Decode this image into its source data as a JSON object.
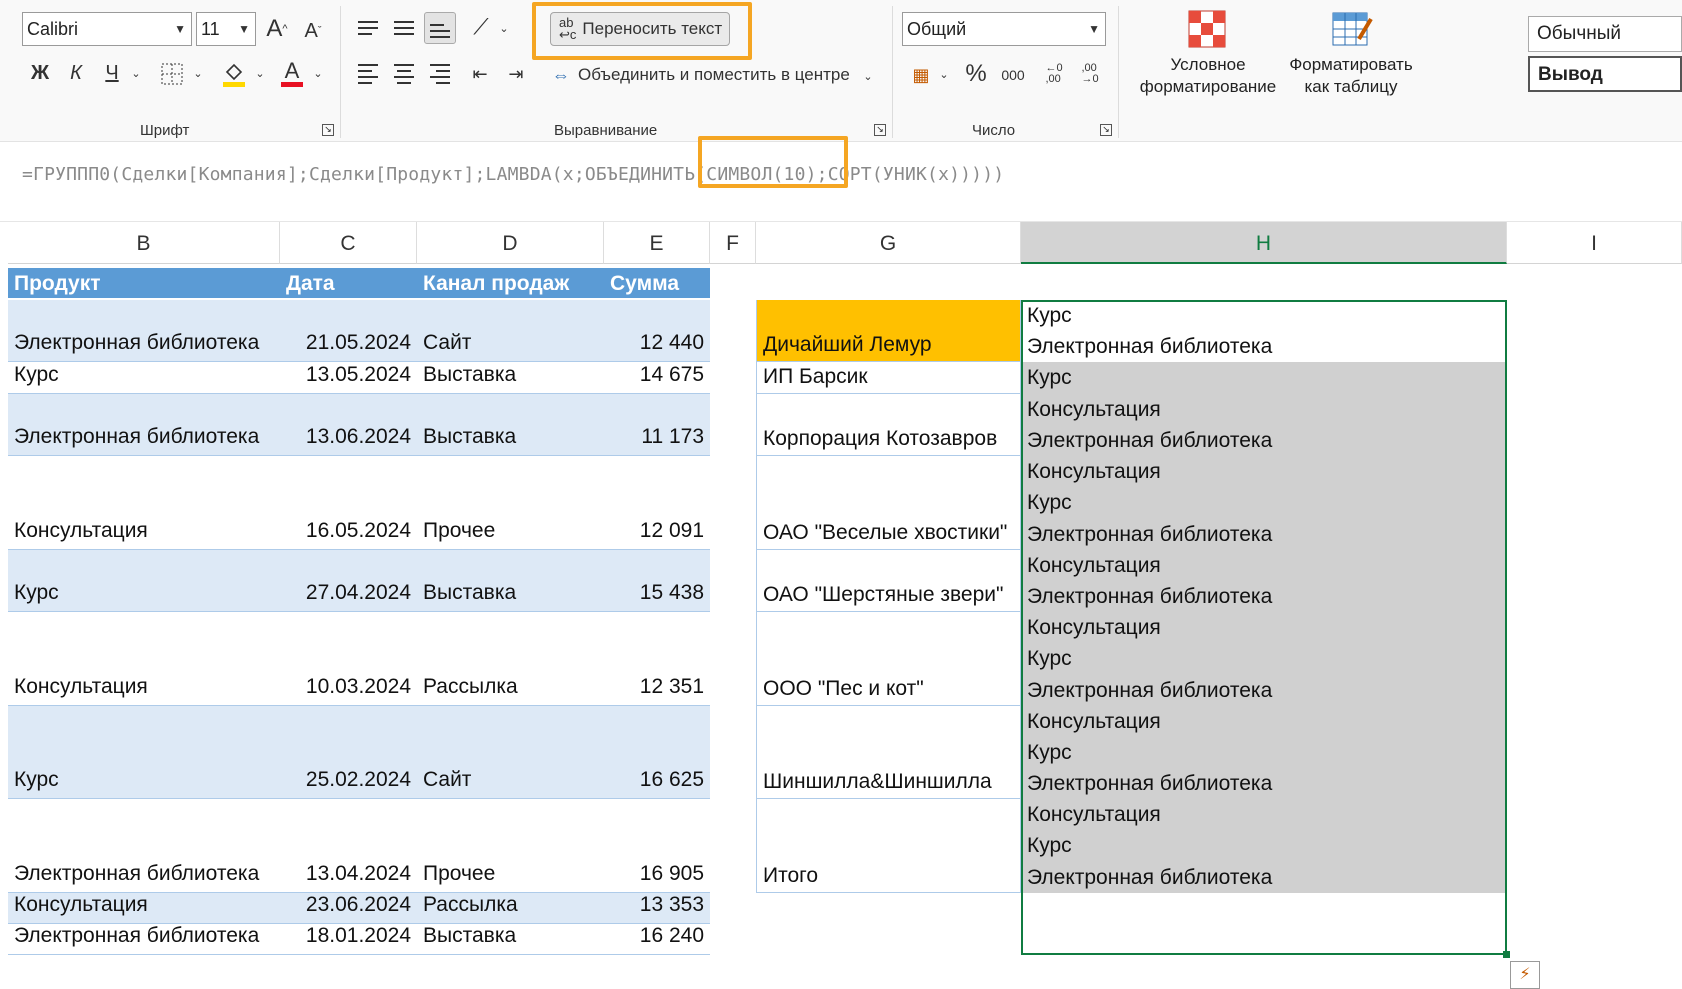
{
  "ribbon": {
    "font": {
      "name": "Calibri",
      "size": "11",
      "bold": "Ж",
      "italic": "К",
      "underline": "Ч",
      "increase": "A",
      "decrease": "A",
      "group_label": "Шрифт",
      "fill_color": "#ffd800",
      "font_color": "#e81123"
    },
    "alignment": {
      "wrap_text": "Переносить текст",
      "merge_center": "Объединить и поместить в центре",
      "group_label": "Выравнивание"
    },
    "number": {
      "format": "Общий",
      "percent": "%",
      "thousands": "000",
      "group_label": "Число"
    },
    "styles": {
      "conditional_formatting": "Условное форматирование",
      "format_as_table": "Форматировать как таблицу",
      "normal": "Обычный",
      "output": "Вывод"
    }
  },
  "formula_bar": {
    "text": "=ГРУППП0(Сделки[Компания];Сделки[Продукт];LAMBDA(x;ОБЪЕДИНИТЬ(СИМВОЛ(10);СОРТ(УНИК(x)))))"
  },
  "columns": [
    "B",
    "C",
    "D",
    "E",
    "F",
    "G",
    "H",
    "I"
  ],
  "table_headers": {
    "product": "Продукт",
    "date": "Дата",
    "channel": "Канал продаж",
    "sum": "Сумма"
  },
  "table_rows": [
    {
      "product": "Электронная библиотека",
      "date": "21.05.2024",
      "channel": "Сайт",
      "sum": "12 440"
    },
    {
      "product": "Курс",
      "date": "13.05.2024",
      "channel": "Выставка",
      "sum": "14 675"
    },
    {
      "product": "Электронная библиотека",
      "date": "13.06.2024",
      "channel": "Выставка",
      "sum": "11 173"
    },
    {
      "product": "Консультация",
      "date": "16.05.2024",
      "channel": "Прочее",
      "sum": "12 091"
    },
    {
      "product": "Курс",
      "date": "27.04.2024",
      "channel": "Выставка",
      "sum": "15 438"
    },
    {
      "product": "Консультация",
      "date": "10.03.2024",
      "channel": "Рассылка",
      "sum": "12 351"
    },
    {
      "product": "Курс",
      "date": "25.02.2024",
      "channel": "Сайт",
      "sum": "16 625"
    },
    {
      "product": "Электронная библиотека",
      "date": "13.04.2024",
      "channel": "Прочее",
      "sum": "16 905"
    },
    {
      "product": "Консультация",
      "date": "23.06.2024",
      "channel": "Рассылка",
      "sum": "13 353"
    },
    {
      "product": "Электронная библиотека",
      "date": "18.01.2024",
      "channel": "Выставка",
      "sum": "16 240"
    }
  ],
  "groups": [
    {
      "company": "Дичайший Лемур",
      "products": [
        "Курс",
        "Электронная библиотека"
      ]
    },
    {
      "company": "ИП Барсик",
      "products": [
        "Курс"
      ]
    },
    {
      "company": "Корпорация Котозавров",
      "products": [
        "Консультация",
        "Электронная библиотека"
      ]
    },
    {
      "company": "ОАО \"Веселые хвостики\"",
      "products": [
        "Консультация",
        "Курс",
        "Электронная библиотека"
      ]
    },
    {
      "company": "ОАО \"Шерстяные звери\"",
      "products": [
        "Консультация",
        "Электронная библиотека"
      ]
    },
    {
      "company": "ООО \"Пес и кот\"",
      "products": [
        "Консультация",
        "Курс",
        "Электронная библиотека"
      ]
    },
    {
      "company": "Шиншилла&Шиншилла",
      "products": [
        "Консультация",
        "Курс",
        "Электронная библиотека"
      ]
    },
    {
      "company": "Итого",
      "products": [
        "Консультация",
        "Курс",
        "Электронная библиотека"
      ]
    }
  ],
  "colors": {
    "accent": "#f5a623",
    "header_blue": "#5b9bd5",
    "band_blue": "#dde9f6",
    "first_group_fill": "#ffc000",
    "spill_gray": "#d0d0d0",
    "selection_green": "#107c41"
  }
}
